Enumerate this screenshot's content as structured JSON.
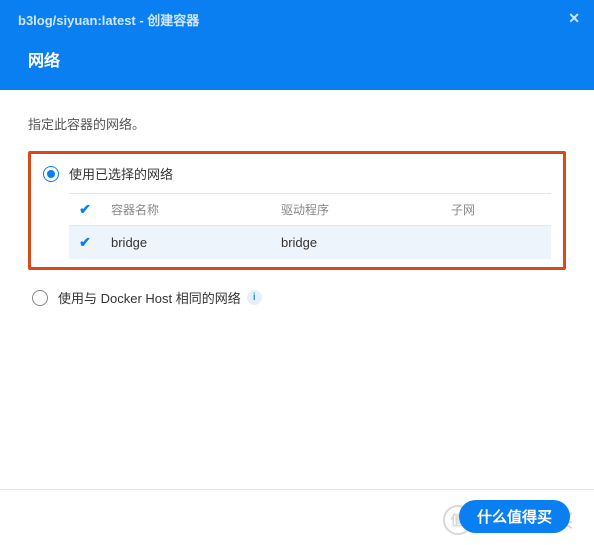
{
  "header": {
    "title": "b3log/siyuan:latest - 创建容器",
    "section": "网络"
  },
  "content": {
    "instruction": "指定此容器的网络。",
    "options": {
      "useSelected": {
        "label": "使用已选择的网络",
        "selected": true
      },
      "useHost": {
        "label": "使用与 Docker Host 相同的网络",
        "selected": false
      }
    },
    "table": {
      "headers": {
        "name": "容器名称",
        "driver": "驱动程序",
        "subnet": "子网"
      },
      "rows": [
        {
          "checked": true,
          "name": "bridge",
          "driver": "bridge",
          "subnet": ""
        }
      ]
    }
  },
  "watermark": {
    "icon": "值",
    "text": "什么值得买"
  }
}
